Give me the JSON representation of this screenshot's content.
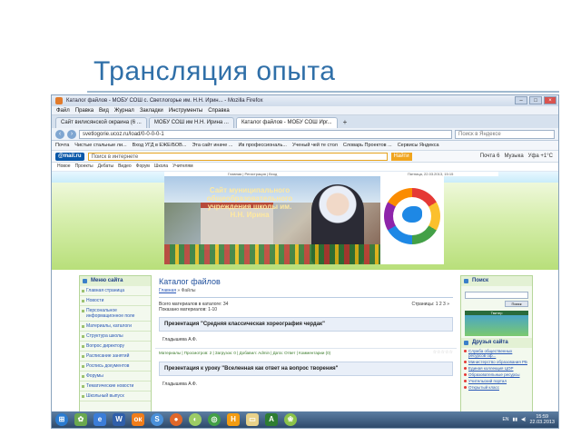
{
  "slide": {
    "title": "Трансляция опыта"
  },
  "browser": {
    "window_title": "Каталог файлов - МОБУ СОШ с. Светлогорье им. Н.Н. Ирин... - Mozilla Firefox",
    "menu": [
      "Файл",
      "Правка",
      "Вид",
      "Журнал",
      "Закладки",
      "Инструменты",
      "Справка"
    ],
    "tabs": [
      {
        "label": "Сайт вилисянской окраина (6 ...",
        "active": false
      },
      {
        "label": "МОБУ СОШ им Н.Н. Ирина ...",
        "active": false
      },
      {
        "label": "Каталог файлов - МОБУ СОШ Ирг...",
        "active": true
      }
    ],
    "new_tab": "+",
    "url": "svetlogorie.ucoz.ru/load/0-0-0-0-1",
    "search_placeholder": "Поиск в Яндексе",
    "bookmarks": [
      "Почта",
      "Чистые стальные ли...",
      "Вход УГД в ЕЖЕ/БОВ...",
      "Эта сайт иначе ...",
      "Ив профессиональ...",
      "Ученый чей те стол",
      "Словарь Проектов ...",
      "Сервисы Яндекса"
    ],
    "mail": {
      "logo": "@mail.ru",
      "search_placeholder": "Поиск в интернете",
      "search_button": "Найти",
      "links": [
        "Почта 6",
        "Музыка",
        "Уфа +1°C"
      ]
    },
    "site_menu": [
      "Новое",
      "Проекты",
      "Дебаты",
      "Видео",
      "Форум",
      "Школа",
      "Учителям"
    ]
  },
  "site": {
    "hero_text": "Сайт муниципального общеобразовательного учреждения школы им. Н.Н. Ирина",
    "hero_strip": "Главная | Регистрация | Вход",
    "date_strip": "Пятница, 22.03.2013, 15:15",
    "left": {
      "menu_title": "Меню сайта",
      "items": [
        "Главная страница",
        "Новости",
        "Персональное информационное поле",
        "Материалы, каталоги",
        "Структура школы",
        "Вопрос директору",
        "Расписание занятий",
        "Роспись документов",
        "Форумы",
        "Тематические новости",
        "Школьный выпуск"
      ]
    },
    "center": {
      "title": "Каталог файлов",
      "crumbs_link": "Главная",
      "crumbs_rest": "» Файлы",
      "stats_line1": "Всего материалов в каталоге: 34",
      "stats_line2": "Показано материалов: 1-10",
      "pages": "Страницы: 1 2 3 »",
      "entries": [
        {
          "title": "Презентация \"Средняя классическая хореография чердак\"",
          "author": "Гладышева А.Ф.",
          "meta": "Материалы | Просмотров: 2 | Загрузок: 0 | Добавил: Admin | Дата: Ответ | Комментарии (0)",
          "rating": "☆☆☆☆☆"
        },
        {
          "title": "Презентация к уроку \"Вселенная как ответ на вопрос творения\"",
          "author": "Гладышева А.Ф."
        }
      ]
    },
    "right": {
      "search_title": "Поиск",
      "search_button": "Поиск",
      "banner_caption": "Твитер",
      "friends_title": "Друзья сайта",
      "links": [
        "Служба общественных ресурсов оф...",
        "Министерство образования РБ",
        "Единая коллекция ЦОР",
        "Образовательные ресурсы",
        "Учительский портал",
        "Открытый класс"
      ]
    }
  },
  "taskbar": {
    "clock_time": "15:59",
    "clock_date": "22.03.2013",
    "tray_lang": "EN"
  },
  "colors": {
    "title_blue": "#2f6fa8",
    "site_green": "#b8df7a",
    "link_blue": "#2756b7"
  }
}
